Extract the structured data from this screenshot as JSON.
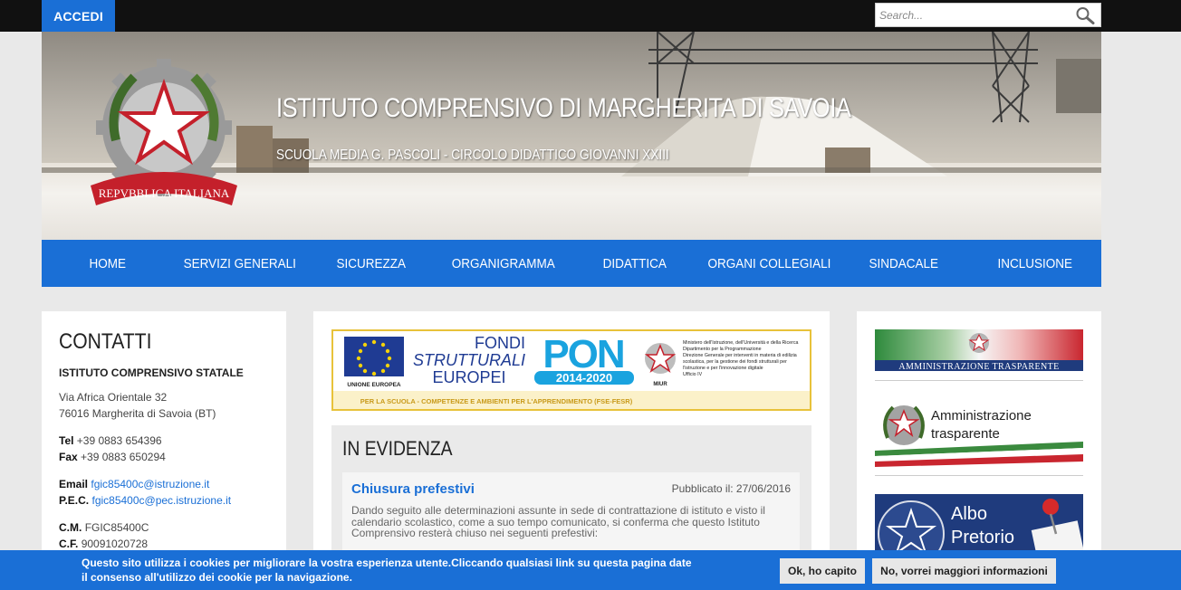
{
  "topbar": {
    "login_label": "ACCEDI",
    "search_placeholder": "Search..."
  },
  "header": {
    "title": "ISTITUTO COMPRENSIVO DI MARGHERITA DI SAVOIA",
    "subtitle": "SCUOLA MEDIA G. PASCOLI - CIRCOLO DIDATTICO GIOVANNI XXIII",
    "emblem_text": "REPVBBLICA ITALIANA"
  },
  "nav": {
    "items": [
      "HOME",
      "SERVIZI GENERALI",
      "SICUREZZA",
      "ORGANIGRAMMA",
      "DIDATTICA",
      "ORGANI COLLEGIALI",
      "SINDACALE",
      "INCLUSIONE"
    ]
  },
  "contatti": {
    "title": "CONTATTI",
    "org": "ISTITUTO COMPRENSIVO STATALE",
    "address1": "Via Africa Orientale 32",
    "address2": "76016 Margherita di Savoia (BT)",
    "tel_label": "Tel",
    "tel": "+39 0883 654396",
    "fax_label": "Fax",
    "fax": "+39 0883 650294",
    "email_label": "Email",
    "email": "fgic85400c@istruzione.it",
    "pec_label": "P.E.C.",
    "pec": "fgic85400c@pec.istruzione.it",
    "cm_label": "C.M.",
    "cm": "FGIC85400C",
    "cf_label": "C.F.",
    "cf": "90091020728"
  },
  "pon": {
    "ue_label": "UNIONE EUROPEA",
    "fondi_line1": "FONDI",
    "fondi_line2": "STRUTTURALI",
    "fondi_line3": "EUROPEI",
    "pon_text": "PON",
    "pon_years": "2014-2020",
    "miur_label": "MIUR",
    "ministry_lines": [
      "Ministero dell'Istruzione, dell'Università e della Ricerca",
      "Dipartimento per la Programmazione",
      "Direzione Generale per interventi in materia di edilizia",
      "scolastica, per la gestione dei fondi strutturali per",
      "l'istruzione e per l'innovazione digitale",
      "Ufficio IV"
    ],
    "footer": "PER LA SCUOLA - COMPETENZE E AMBIENTI PER L'APPRENDIMENTO (FSE-FESR)"
  },
  "evidenza": {
    "title": "IN EVIDENZA",
    "news_title": "Chiusura prefestivi",
    "news_date": "Pubblicato il: 27/06/2016",
    "news_body": "Dando seguito alle determinazioni assunte in sede di contrattazione di istituto e visto il calendario scolastico, come a suo tempo comunicato, si conferma che questo Istituto Comprensivo resterà chiuso nei seguenti prefestivi:"
  },
  "sidebar": {
    "banner1": "AMMINISTRAZIONE TRASPARENTE",
    "banner2_line1": "Amministrazione",
    "banner2_line2": "trasparente",
    "banner3_line1": "Albo",
    "banner3_line2": "Pretorio"
  },
  "cookie": {
    "text": "Questo sito utilizza i cookies per migliorare la vostra esperienza utente.Cliccando qualsiasi link su questa pagina date il consenso all'utilizzo dei cookie per la navigazione.",
    "ok_label": "Ok, ho capito",
    "more_label": "No, vorrei maggiori informazioni"
  },
  "colors": {
    "accent": "#1a6fd6",
    "topbar": "#111111",
    "pon_border": "#e8c23a"
  }
}
